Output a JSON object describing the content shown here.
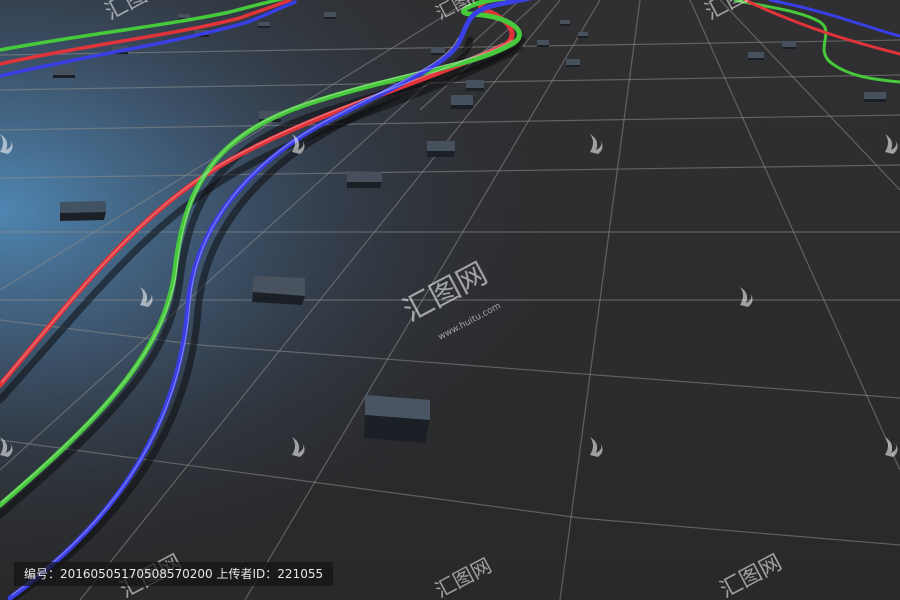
{
  "scene": {
    "description_colors": {
      "floor_dark": "#2b2b2d",
      "floor_blue_glow": "#3f6f98",
      "grid_line": "#8a8a8a",
      "block_top": "#4a5563",
      "block_side": "#1a1f26",
      "cable_red": "#e0343a",
      "cable_green": "#46c93a",
      "cable_blue": "#3a3ee6"
    }
  },
  "caption": {
    "text": "编号：20160505170508570200 上传者ID：221055"
  },
  "watermark": {
    "logo_text": "汇图网",
    "url_text": "www.huitu.com"
  }
}
